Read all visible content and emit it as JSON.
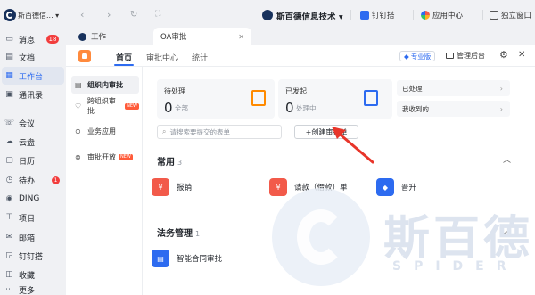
{
  "topbar": {
    "org_name": "斯百德信...",
    "center_title": "斯百德信息技术",
    "actions": [
      {
        "label": "钉钉搭",
        "icon": "dingda-icon"
      },
      {
        "label": "应用中心",
        "icon": "app-center-icon"
      },
      {
        "label": "独立窗口",
        "icon": "window-icon"
      }
    ]
  },
  "rail": {
    "items": [
      {
        "label": "消息",
        "icon": "message-icon",
        "badge": "18"
      },
      {
        "label": "文档",
        "icon": "doc-icon"
      },
      {
        "label": "工作台",
        "icon": "workbench-icon",
        "active": true
      },
      {
        "label": "通讯录",
        "icon": "contacts-icon"
      },
      {
        "label": "会议",
        "icon": "meeting-icon"
      },
      {
        "label": "云盘",
        "icon": "cloud-icon"
      },
      {
        "label": "日历",
        "icon": "calendar-icon"
      },
      {
        "label": "待办",
        "icon": "todo-icon",
        "badge": "1"
      },
      {
        "label": "DING",
        "icon": "ding-icon"
      },
      {
        "label": "项目",
        "icon": "project-icon"
      },
      {
        "label": "邮箱",
        "icon": "mail-icon"
      },
      {
        "label": "钉钉搭",
        "icon": "dingda-icon"
      },
      {
        "label": "收藏",
        "icon": "favorite-icon"
      },
      {
        "label": "更多",
        "icon": "more-icon"
      }
    ]
  },
  "tabs": [
    {
      "label": "工作"
    },
    {
      "label": "OA审批",
      "close": "✕"
    }
  ],
  "app": {
    "tabs": [
      "首页",
      "审批中心",
      "统计"
    ],
    "pro_label": "专业版",
    "admin_label": "管理后台",
    "sidebar": [
      {
        "label": "组织内审批",
        "active": true
      },
      {
        "label": "跨组织审批",
        "new": "NEW"
      },
      {
        "label": "业务应用"
      },
      {
        "label": "审批开放",
        "new": "NEW"
      }
    ],
    "stats": [
      {
        "label": "待处理",
        "value": "0",
        "sub": "全部",
        "color": "#ff8a00"
      },
      {
        "label": "已发起",
        "value": "0",
        "sub": "处理中",
        "color": "#2d6bf0"
      }
    ],
    "side_links": [
      "已处理",
      "我收到的"
    ],
    "search_placeholder": "请搜索要提交的表单",
    "create_label": "+创建审批单",
    "common": {
      "title": "常用",
      "count": "3",
      "items": [
        {
          "label": "报销",
          "color": "#f25a4a"
        },
        {
          "label": "请款（借款）单",
          "color": "#f25a4a"
        },
        {
          "label": "晋升",
          "color": "#2d6bf0"
        }
      ]
    },
    "law": {
      "title": "法务管理",
      "count": "1",
      "items": [
        {
          "label": "智能合同审批",
          "color": "#2d6bf0"
        }
      ]
    }
  },
  "watermark": {
    "text": "斯百德",
    "sub": "SPIDER"
  }
}
